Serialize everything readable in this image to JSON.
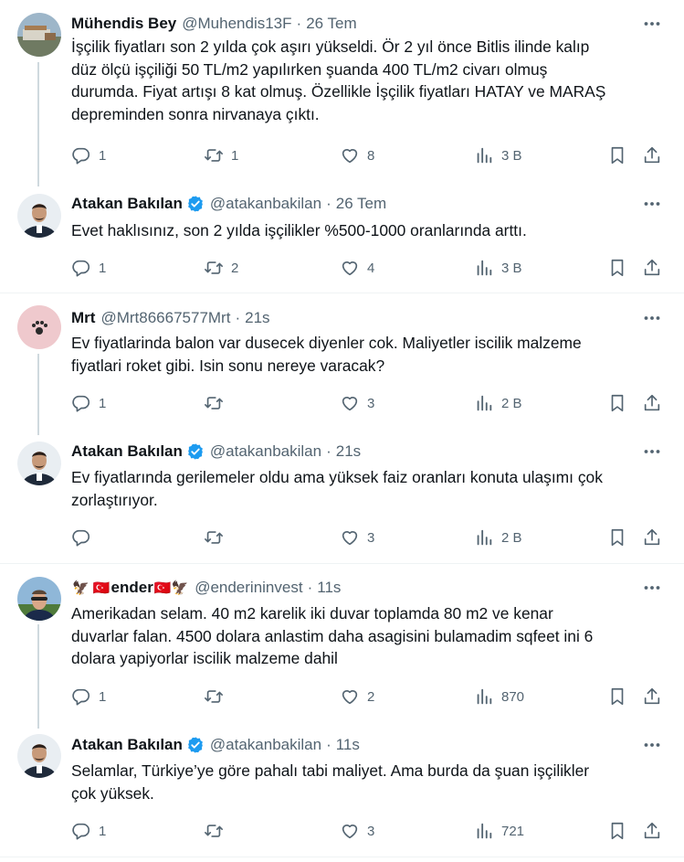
{
  "tweets": [
    {
      "name": "Mühendis Bey",
      "handle": "@Muhendis13F",
      "time": "26 Tem",
      "verified": false,
      "text": "İşçilik fiyatları son 2 yılda çok aşırı yükseldi. Ör 2 yıl önce Bitlis ilinde kalıp\ndüz ölçü işçiliği 50 TL/m2 yapılırken şuanda 400 TL/m2 civarı olmuş\ndurumda. Fiyat artışı 8 kat olmuş. Özellikle İşçilik fiyatları HATAY ve MARAŞ\ndepreminden sonra nirvanaya çıktı.",
      "replies": "1",
      "retweets": "1",
      "likes": "8",
      "views": "3 B"
    },
    {
      "name": "Atakan Bakılan",
      "handle": "@atakanbakilan",
      "time": "26 Tem",
      "verified": true,
      "text": "Evet haklısınız, son 2 yılda işçilikler %500-1000 oranlarında arttı.",
      "replies": "1",
      "retweets": "2",
      "likes": "4",
      "views": "3 B"
    },
    {
      "name": "Mrt",
      "handle": "@Mrt86667577Mrt",
      "time": "21s",
      "verified": false,
      "text": "Ev fiyatlarinda balon var dusecek diyenler cok. Maliyetler iscilik malzeme\nfiyatlari roket gibi. Isin sonu nereye varacak?",
      "replies": "1",
      "retweets": "",
      "likes": "3",
      "views": "2 B"
    },
    {
      "name": "Atakan Bakılan",
      "handle": "@atakanbakilan",
      "time": "21s",
      "verified": true,
      "text": "Ev fiyatlarında gerilemeler oldu ama yüksek faiz oranları konuta ulaşımı çok\nzorlaştırıyor.",
      "replies": "",
      "retweets": "",
      "likes": "3",
      "views": "2 B"
    },
    {
      "name": "ender",
      "name_prefix": "🦅 🇹🇷",
      "name_suffix": "🇹🇷🦅",
      "handle": "@enderininvest",
      "time": "11s",
      "verified": false,
      "text": "Amerikadan selam. 40 m2 karelik iki duvar toplamda 80 m2 ve kenar\nduvarlar falan. 4500 dolara anlastim daha asagisini bulamadim sqfeet ini 6\ndolara yapiyorlar iscilik malzeme dahil",
      "replies": "1",
      "retweets": "",
      "likes": "2",
      "views": "870"
    },
    {
      "name": "Atakan Bakılan",
      "handle": "@atakanbakilan",
      "time": "11s",
      "verified": true,
      "text": "Selamlar, Türkiye’ye göre pahalı tabi maliyet. Ama burda da şuan işçilikler\nçok yüksek.",
      "replies": "1",
      "retweets": "",
      "likes": "3",
      "views": "721"
    }
  ],
  "dot": "·",
  "colors": {
    "verified": "#1d9bf0",
    "secondary": "#536471",
    "line": "#cfd9de"
  }
}
